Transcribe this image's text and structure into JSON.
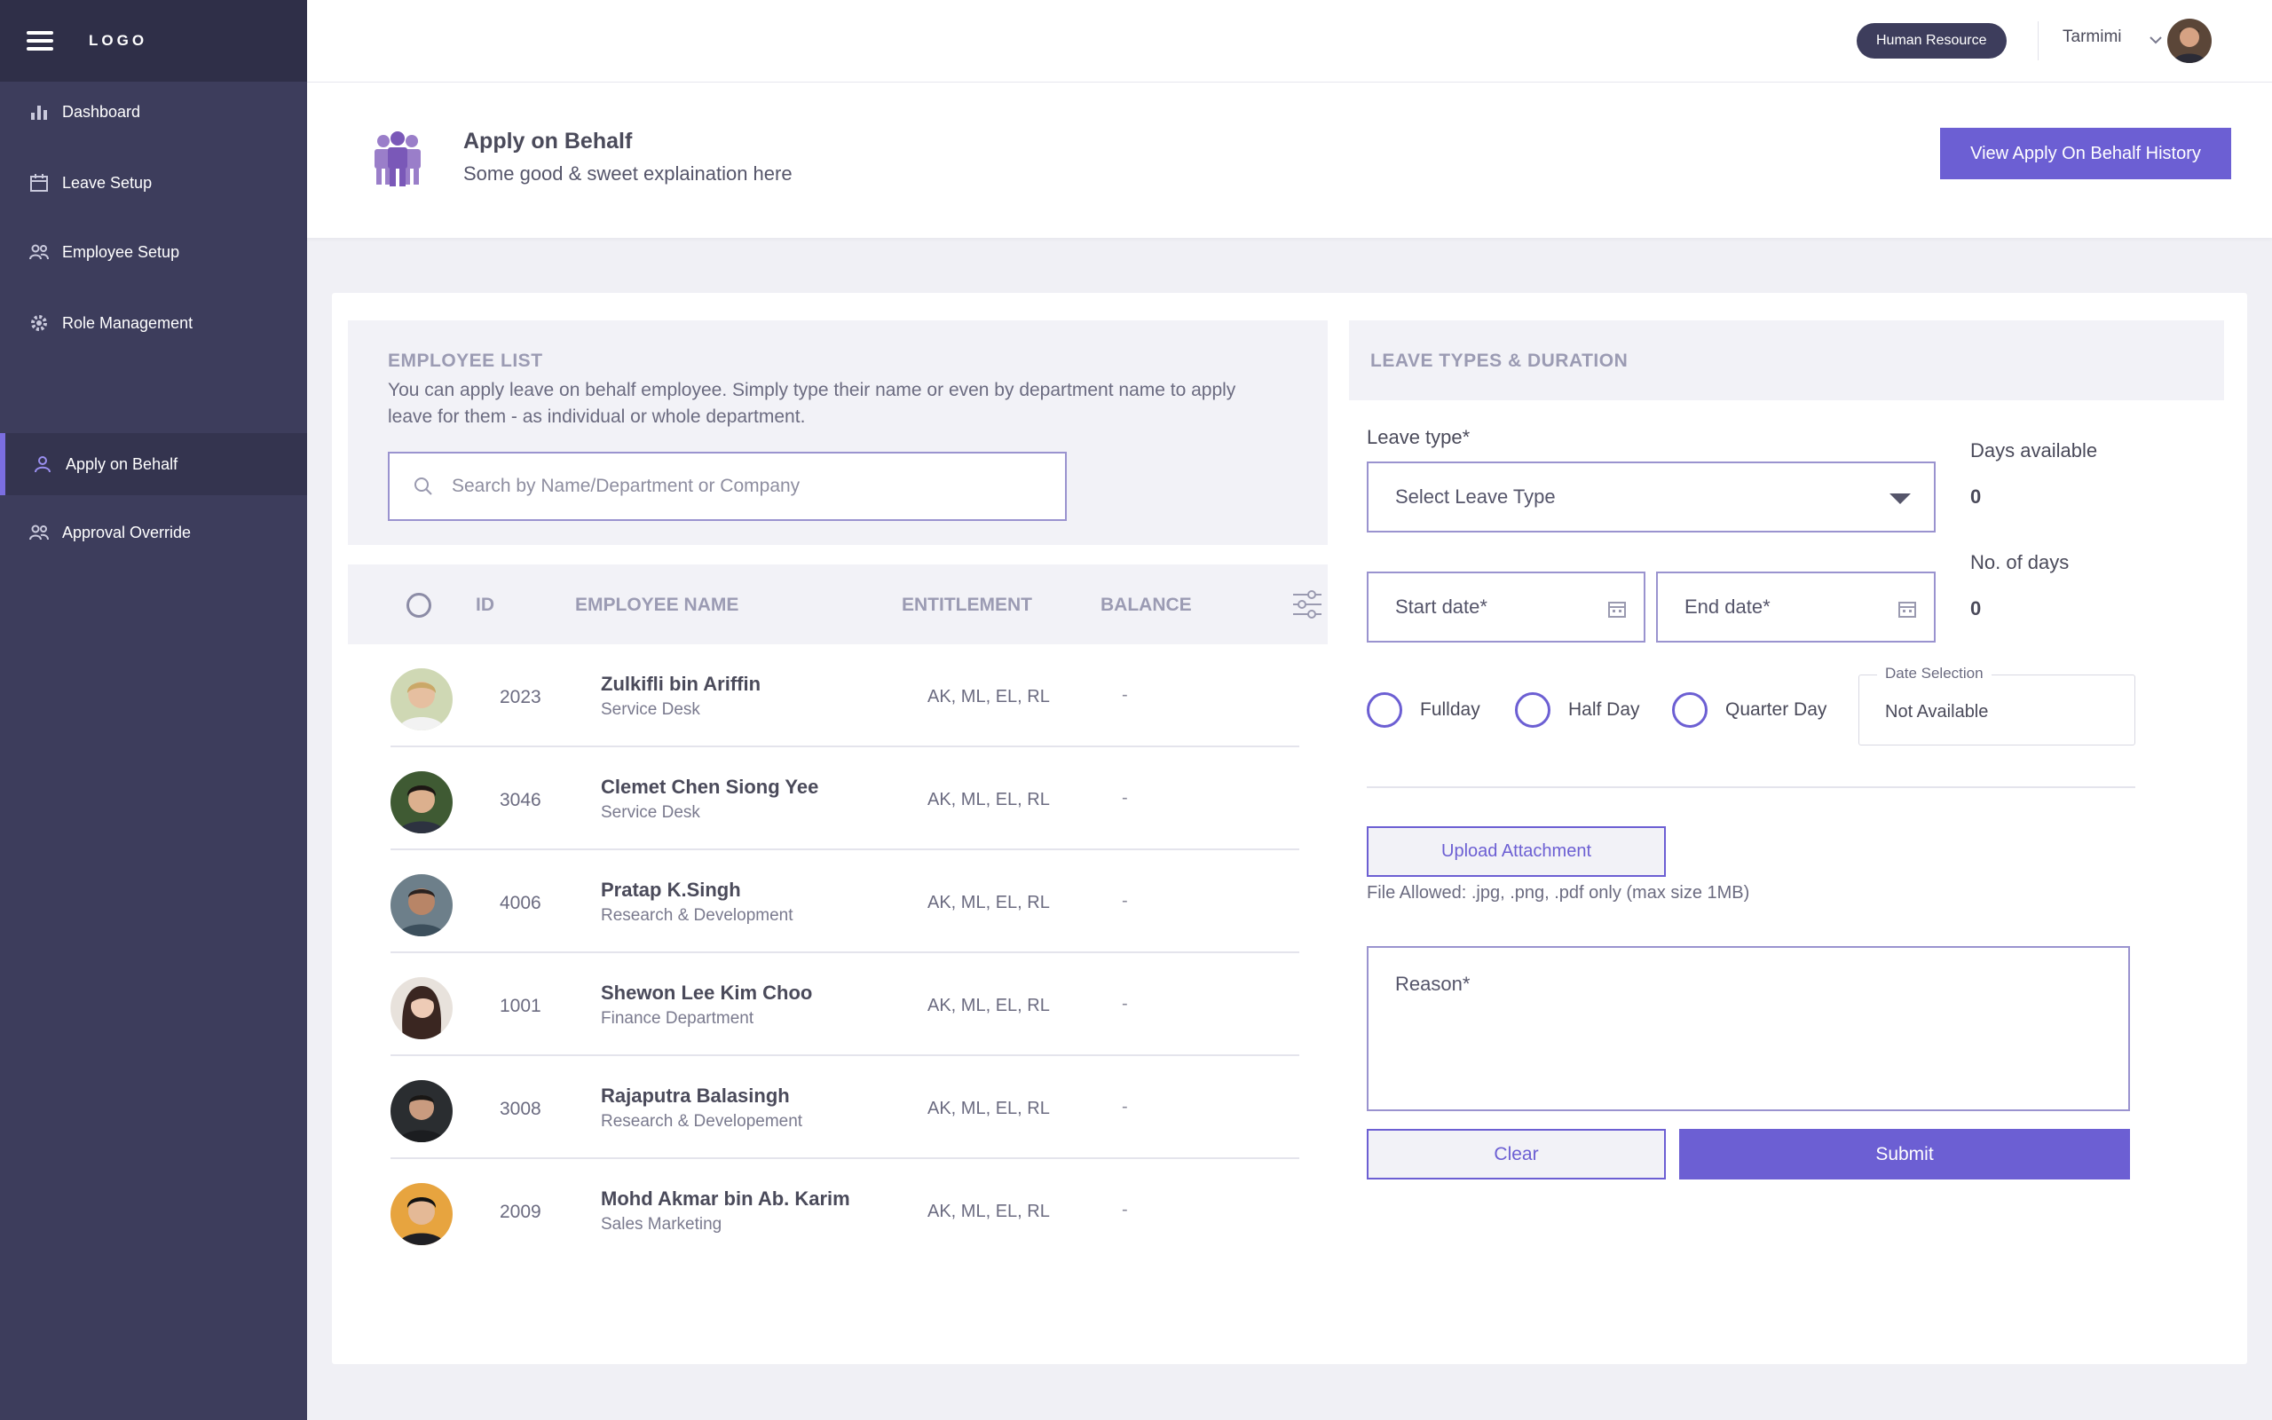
{
  "app": {
    "logo": "LOGO"
  },
  "sidebar": {
    "items": [
      {
        "label": "Dashboard",
        "icon": "bar-chart-icon"
      },
      {
        "label": "Leave Setup",
        "icon": "calendar-icon"
      },
      {
        "label": "Employee Setup",
        "icon": "users-icon"
      },
      {
        "label": "Role Management",
        "icon": "gear-icon"
      },
      {
        "label": "Apply on Behalf",
        "icon": "user-icon",
        "active": true
      },
      {
        "label": "Approval Override",
        "icon": "users-icon"
      }
    ]
  },
  "topbar": {
    "role": "Human Resource",
    "user_name": "Tarmimi"
  },
  "header": {
    "title": "Apply on Behalf",
    "subtitle": "Some good & sweet explaination here",
    "history_button": "View Apply On Behalf History"
  },
  "employee_list": {
    "title": "EMPLOYEE LIST",
    "description": "You can apply leave on behalf employee. Simply type their name or even by department name to apply leave for them - as individual or whole department.",
    "search_placeholder": "Search by Name/Department or Company",
    "columns": [
      "ID",
      "EMPLOYEE NAME",
      "ENTITLEMENT",
      "BALANCE"
    ],
    "rows": [
      {
        "id": "2023",
        "name": "Zulkifli bin Ariffin",
        "dept": "Service Desk",
        "entitlement": "AK, ML, EL, RL",
        "balance": "-"
      },
      {
        "id": "3046",
        "name": "Clemet Chen Siong Yee",
        "dept": "Service Desk",
        "entitlement": "AK, ML, EL, RL",
        "balance": "-"
      },
      {
        "id": "4006",
        "name": "Pratap K.Singh",
        "dept": "Research & Development",
        "entitlement": "AK, ML, EL, RL",
        "balance": "-"
      },
      {
        "id": "1001",
        "name": "Shewon Lee Kim Choo",
        "dept": "Finance Department",
        "entitlement": "AK, ML, EL, RL",
        "balance": "-"
      },
      {
        "id": "3008",
        "name": "Rajaputra Balasingh",
        "dept": "Research & Developement",
        "entitlement": "AK, ML, EL, RL",
        "balance": "-"
      },
      {
        "id": "2009",
        "name": "Mohd Akmar bin Ab. Karim",
        "dept": "Sales Marketing",
        "entitlement": "AK, ML, EL, RL",
        "balance": "-"
      }
    ]
  },
  "leave_form": {
    "title": "LEAVE TYPES & DURATION",
    "leave_type_label": "Leave type*",
    "leave_type_value": "Select Leave Type",
    "start_date": "Start date*",
    "end_date": "End date*",
    "days_available_label": "Days available",
    "days_available_value": "0",
    "no_of_days_label": "No. of days",
    "no_of_days_value": "0",
    "duration_options": [
      "Fullday",
      "Half Day",
      "Quarter Day"
    ],
    "date_selection_label": "Date Selection",
    "date_selection_value": "Not Available",
    "upload_button": "Upload Attachment",
    "file_note": "File Allowed: .jpg, .png, .pdf only (max size 1MB)",
    "reason_placeholder": "Reason*",
    "clear_button": "Clear",
    "submit_button": "Submit"
  },
  "colors": {
    "sidebar": "#3d3d5c",
    "accent": "#6c5fd3",
    "background": "#f0f0f5"
  }
}
